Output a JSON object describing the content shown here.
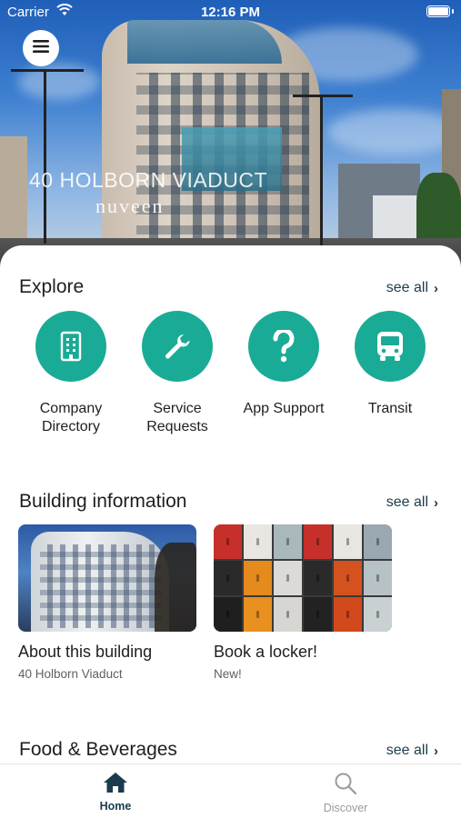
{
  "status_bar": {
    "carrier": "Carrier",
    "time": "12:16 PM"
  },
  "hero": {
    "title": "40 HOLBORN VIADUCT",
    "brand": "nuveen"
  },
  "explore": {
    "title": "Explore",
    "see_all": "see all",
    "items": [
      {
        "label": "Company\nDirectory",
        "icon": "building-icon"
      },
      {
        "label": "Service\nRequests",
        "icon": "wrench-icon"
      },
      {
        "label": "App Support",
        "icon": "question-icon"
      },
      {
        "label": "Transit",
        "icon": "bus-icon"
      }
    ]
  },
  "building_info": {
    "title": "Building information",
    "see_all": "see all",
    "cards": [
      {
        "title": "About this building",
        "subtitle": "40 Holborn Viaduct"
      },
      {
        "title": "Book a locker!",
        "subtitle": "New!"
      }
    ]
  },
  "food": {
    "title": "Food & Beverages",
    "see_all": "see all"
  },
  "tabs": [
    {
      "label": "Home",
      "icon": "home-icon",
      "active": true
    },
    {
      "label": "Discover",
      "icon": "search-icon",
      "active": false
    }
  ],
  "colors": {
    "accent": "#1aab96",
    "link": "#1a3b4d",
    "inactive": "#9a9a9a"
  }
}
